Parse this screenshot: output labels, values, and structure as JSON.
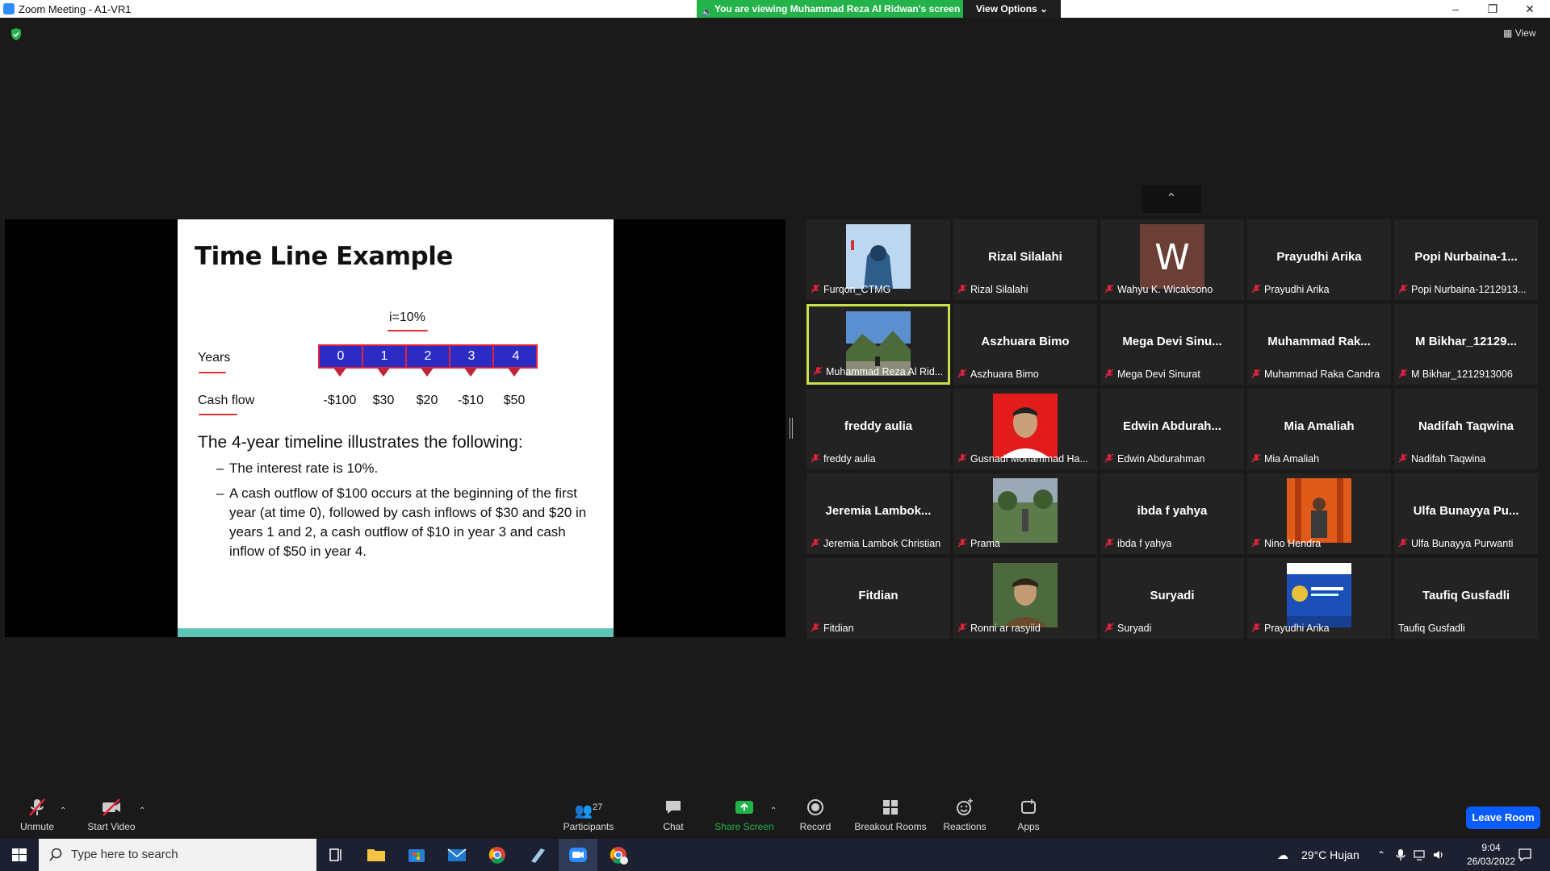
{
  "window": {
    "title": "Zoom Meeting - A1-VR1",
    "controls": [
      "minimize",
      "restore",
      "close"
    ]
  },
  "banner": {
    "viewing_text": "You are viewing Muhammad Reza Al Ridwan's screen",
    "view_options": "View Options ⌄"
  },
  "top_right": {
    "view_label": "View"
  },
  "slide": {
    "title": "Time Line Example",
    "rate": "i=10%",
    "years_label": "Years",
    "cashflow_label": "Cash flow",
    "periods": [
      "0",
      "1",
      "2",
      "3",
      "4"
    ],
    "cashflows": [
      "-$100",
      "$30",
      "$20",
      "-$10",
      "$50"
    ],
    "heading": "The 4-year timeline illustrates the following:",
    "bullet_1": "The interest rate is 10%.",
    "bullet_2": "A cash outflow of $100 occurs at the beginning of the first year (at time 0), followed by cash inflows of $30 and $20 in years 1 and 2, a cash outflow of $10 in year 3 and cash inflow of $50 in year 4."
  },
  "participants": [
    {
      "big": "",
      "name": "Furqon_CTMG",
      "photo": "person-hoodie",
      "muted": true
    },
    {
      "big": "Rizal Silalahi",
      "name": "Rizal Silalahi",
      "photo": "",
      "muted": true
    },
    {
      "big": "",
      "name": "Wahyu K. Wicaksono",
      "photo": "letter-w",
      "muted": true
    },
    {
      "big": "Prayudhi Arika",
      "name": "Prayudhi Arika",
      "photo": "",
      "muted": true
    },
    {
      "big": "Popi  Nurbaina-1...",
      "name": "Popi Nurbaina-1212913...",
      "photo": "",
      "muted": true
    },
    {
      "big": "",
      "name": "Muhammad Reza Al Rid...",
      "photo": "mountain",
      "muted": true,
      "active": true
    },
    {
      "big": "Aszhuara Bimo",
      "name": "Aszhuara Bimo",
      "photo": "",
      "muted": true
    },
    {
      "big": "Mega  Devi  Sinu...",
      "name": "Mega Devi Sinurat",
      "photo": "",
      "muted": true
    },
    {
      "big": "Muhammad  Rak...",
      "name": "Muhammad Raka Candra",
      "photo": "",
      "muted": true
    },
    {
      "big": "M  Bikhar_12129...",
      "name": "M Bikhar_1212913006",
      "photo": "",
      "muted": true
    },
    {
      "big": "freddy aulia",
      "name": "freddy aulia",
      "photo": "",
      "muted": true
    },
    {
      "big": "",
      "name": "Gusnadi Mohammad Ha...",
      "photo": "portrait-red",
      "muted": true
    },
    {
      "big": "Edwin  Abdurah...",
      "name": "Edwin Abdurahman",
      "photo": "",
      "muted": true
    },
    {
      "big": "Mia Amaliah",
      "name": "Mia Amaliah",
      "photo": "",
      "muted": true
    },
    {
      "big": "Nadifah Taqwina",
      "name": "Nadifah Taqwina",
      "photo": "",
      "muted": true
    },
    {
      "big": "Jeremia  Lambok...",
      "name": "Jeremia Lambok Christian",
      "photo": "",
      "muted": true
    },
    {
      "big": "",
      "name": "Prama",
      "photo": "garden",
      "muted": true
    },
    {
      "big": "ibda f yahya",
      "name": "ibda f yahya",
      "photo": "",
      "muted": true
    },
    {
      "big": "",
      "name": "Nino Hendra",
      "photo": "torii",
      "muted": true
    },
    {
      "big": "Ulfa  Bunayya  Pu...",
      "name": "Ulfa Bunayya Purwanti",
      "photo": "",
      "muted": true
    },
    {
      "big": "Fitdian",
      "name": "Fitdian",
      "photo": "",
      "muted": true
    },
    {
      "big": "",
      "name": "Ronni ar rasyiid",
      "photo": "portrait-green",
      "muted": true
    },
    {
      "big": "Suryadi",
      "name": "Suryadi",
      "photo": "",
      "muted": true
    },
    {
      "big": "",
      "name": "Prayudhi Arika",
      "photo": "poster-blue",
      "muted": true
    },
    {
      "big": "Taufiq Gusfadli",
      "name": "Taufiq Gusfadli",
      "photo": "",
      "muted": false
    }
  ],
  "toolbar": {
    "unmute": "Unmute",
    "start_video": "Start Video",
    "participants": "Participants",
    "participants_count": "27",
    "chat": "Chat",
    "share_screen": "Share Screen",
    "record": "Record",
    "breakout_rooms": "Breakout Rooms",
    "reactions": "Reactions",
    "apps": "Apps",
    "leave": "Leave Room"
  },
  "taskbar": {
    "search_placeholder": "Type here to search",
    "weather": "29°C  Hujan",
    "time": "9:04",
    "date": "26/03/2022"
  },
  "colors": {
    "share_green": "#23b34a",
    "leave_blue": "#0b5cff",
    "active_border": "#c8e04a",
    "mute_red": "#e0233a"
  }
}
